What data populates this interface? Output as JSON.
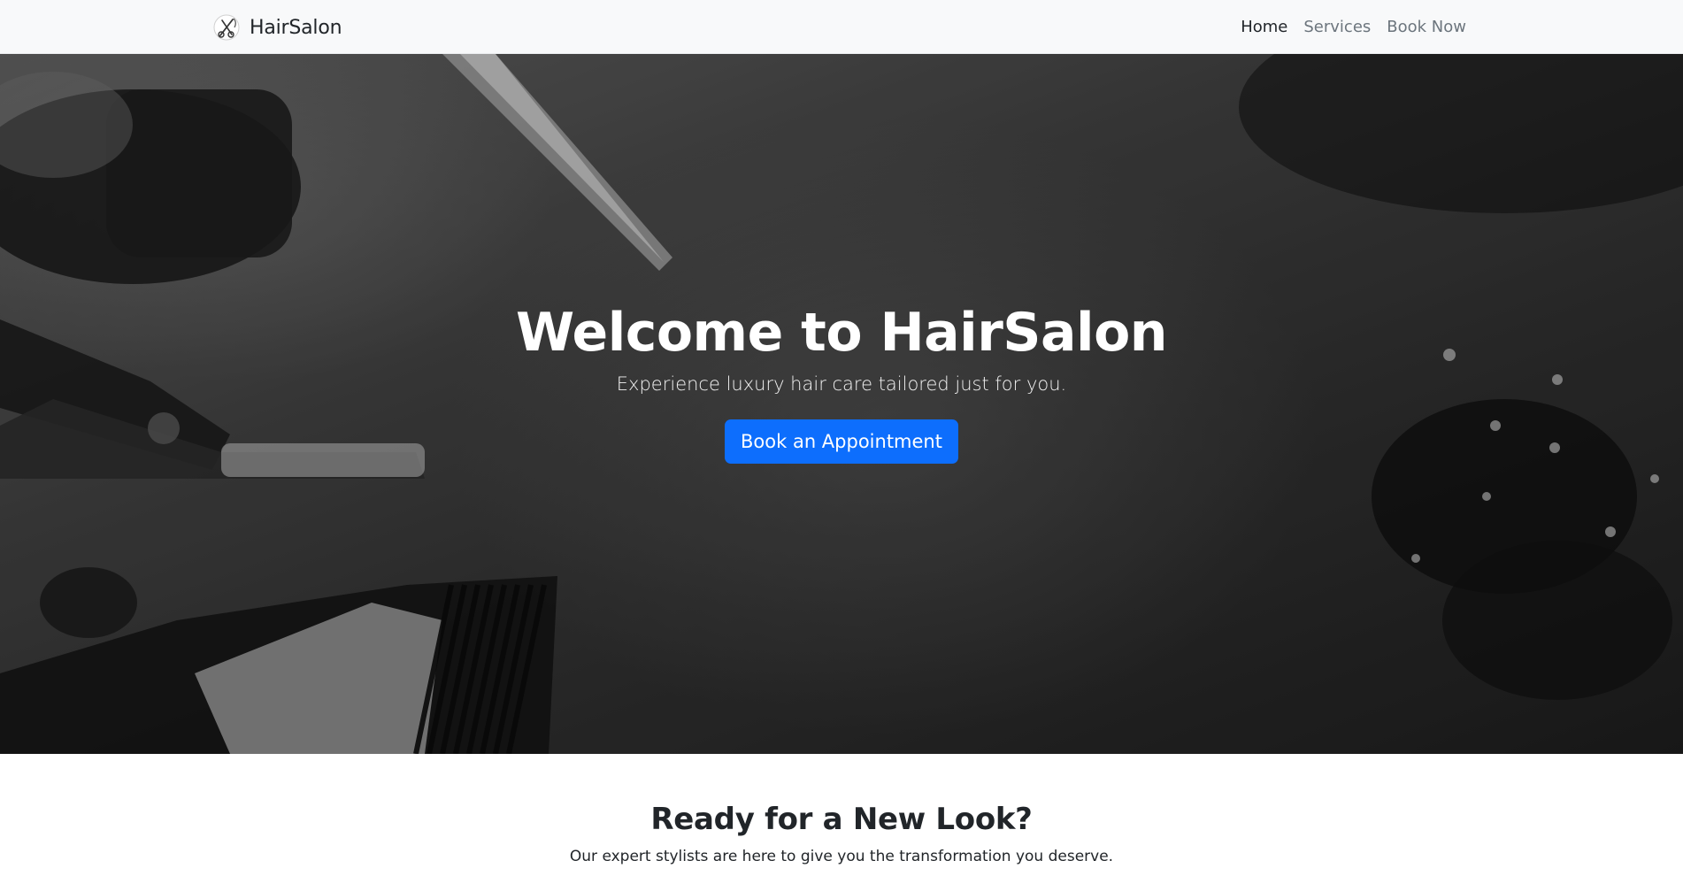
{
  "navbar": {
    "brand": "HairSalon",
    "links": [
      {
        "label": "Home",
        "active": true
      },
      {
        "label": "Services",
        "active": false
      },
      {
        "label": "Book Now",
        "active": false
      }
    ]
  },
  "hero": {
    "title": "Welcome to HairSalon",
    "subtitle": "Experience luxury hair care tailored just for you.",
    "button_label": "Book an Appointment"
  },
  "cta": {
    "title": "Ready for a New Look?",
    "text": "Our expert stylists are here to give you the transformation you deserve."
  },
  "colors": {
    "primary": "#0d6efd",
    "navbar_bg": "#f8f9fa",
    "text_dark": "#212529",
    "nav_muted": "#6c757d"
  },
  "icons": {
    "brand_logo": "scissors-logo-icon"
  }
}
